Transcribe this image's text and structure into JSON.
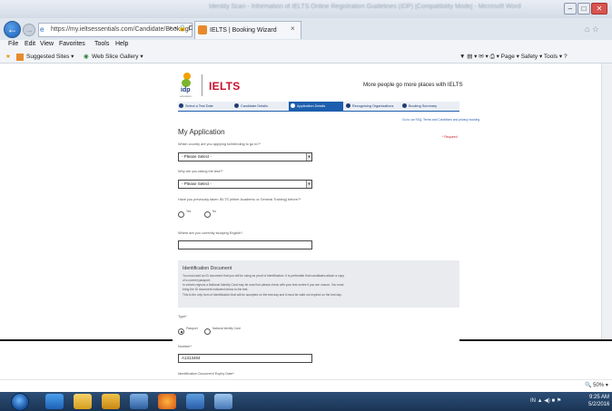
{
  "browser": {
    "window_title": "Identity Scan - Information of IELTS Online Registration Guidelines (IDP) [Compatibility Mode] - Microsoft Word",
    "address": "https://my.ieltsessentials.com/Candidate/Booking/",
    "address_icons": "⌕ ▾ 🔒 C",
    "tab_title": "IELTS | Booking Wizard",
    "tab_close": "×",
    "back_glyph": "←",
    "fwd_glyph": "→",
    "top_right_icons": "⌂ ☆",
    "window_buttons": [
      "–",
      "□"
    ],
    "menu": [
      "File",
      "Edit",
      "View",
      "Favorites",
      "Tools",
      "Help"
    ],
    "favorites": [
      "Suggested Sites ▾",
      "Web Slice Gallery ▾"
    ],
    "command_bar": "▼ ▤ ▾ ✉ ▾ ⎙ ▾  Page ▾  Safety ▾  Tools ▾  ?",
    "zoom": "🔍 50%  ▾"
  },
  "header": {
    "idp_logo_text": "idp",
    "idp_logo_sub": "education",
    "ielts_logo_text": "IELTS",
    "tagline": "More people go more places with IELTS"
  },
  "steps": [
    {
      "label": "Select a Test Date",
      "active": false
    },
    {
      "label": "Candidate Details",
      "active": false
    },
    {
      "label": "Application Details",
      "active": true
    },
    {
      "label": "Recognising Organisations",
      "active": false
    },
    {
      "label": "Booking Summary",
      "active": false
    }
  ],
  "tiny_link": "Go to our FAQ, Terms and Conditions and privacy booking",
  "form": {
    "title": "My Application",
    "required_note": "* Required",
    "q1_label": "Which country are you applying to/intending to go to?*",
    "q1_value": "- Please Select -",
    "q2_label": "Why are you taking the test?*",
    "q2_value": "- Please Select -",
    "q3_label": "Have you previously taken IELTS (either Academic or General Training) before?*",
    "q3_options": [
      "Yes",
      "No"
    ],
    "q4_label": "Where are you currently studying English?",
    "q4_value": "",
    "id_section": {
      "title": "Identification Document",
      "lines": [
        "You must add an ID document that you will be using as proof of identification. It is preferable that candidates attach a copy",
        "of a current passport.",
        "In certain regions a National Identity Card may be used but please check with your test centre if you are unsure. You must",
        "bring the ID document indicated below to the test.",
        "This is the only form of identification that will be accepted on the test day and it must be valid not expired on the test day."
      ]
    },
    "type_label": "Type*",
    "type_options": [
      "Passport",
      "National Identity Card"
    ],
    "number_label": "Number*",
    "number_value": "A1313484",
    "expiry_label": "Identification Document Expiry Date*"
  },
  "taskbar": {
    "tray_text": "IN  ▲  ◀)  ■  ⚑",
    "time": "9:25 AM",
    "date": "5/2/2016"
  },
  "colors": {
    "accent": "#1d5fae",
    "ielts_red": "#c8102e",
    "taskbar": "#1f3b5f"
  }
}
